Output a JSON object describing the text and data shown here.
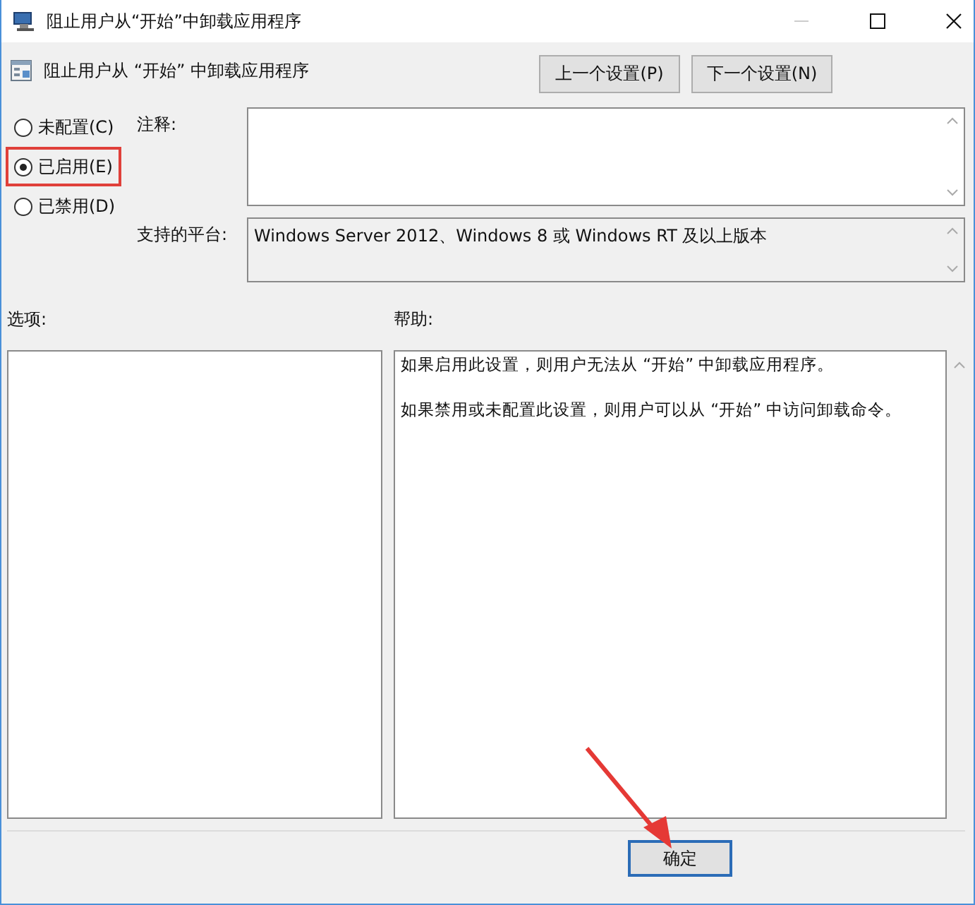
{
  "window": {
    "title": "阻止用户从“开始”中卸载应用程序"
  },
  "header": {
    "title": "阻止用户从 “开始” 中卸载应用程序",
    "buttons": [
      "上一个设置(P)",
      "下一个设置(N)"
    ]
  },
  "state_options": [
    {
      "label": "未配置(C)",
      "selected": false
    },
    {
      "label": "已启用(E)",
      "selected": true
    },
    {
      "label": "已禁用(D)",
      "selected": false
    }
  ],
  "comment": {
    "label": "注释:"
  },
  "platform": {
    "label": "支持的平台:",
    "value": "Windows Server 2012、Windows 8 或 Windows RT 及以上版本"
  },
  "options": {
    "label": "选项:"
  },
  "help": {
    "label": "帮助:",
    "paragraphs": [
      "如果启用此设置，则用户无法从 “开始” 中卸载应用程序。",
      "如果禁用或未配置此设置，则用户可以从 “开始” 中访问卸载命令。"
    ]
  },
  "footer": {
    "buttons": [
      "确定"
    ]
  }
}
